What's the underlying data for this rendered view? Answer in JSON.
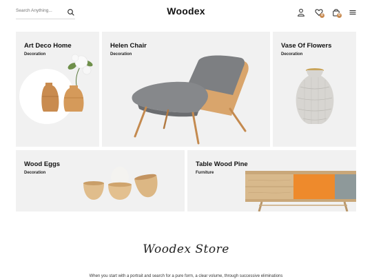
{
  "header": {
    "search_placeholder": "Search Anything...",
    "logo": "Woodex",
    "wishlist_count": "0",
    "cart_count": "0",
    "icons": [
      "search-icon",
      "user-icon",
      "heart-icon",
      "bag-icon",
      "menu-icon"
    ]
  },
  "tiles": [
    {
      "title": "Art Deco Home",
      "category": "Decoration"
    },
    {
      "title": "Helen Chair",
      "category": "Decoration"
    },
    {
      "title": "Vase Of Flowers",
      "category": "Decoration"
    },
    {
      "title": "Wood Eggs",
      "category": "Decoration"
    },
    {
      "title": "Table Wood Pine",
      "category": "Furniture"
    }
  ],
  "store": {
    "signature": "Woodex Store",
    "description": "When you start with a portrait and search for a pure form, a clear volume, through successive eliminations"
  },
  "colors": {
    "accent": "#c8894f",
    "tile_bg": "#f1f1f1"
  }
}
